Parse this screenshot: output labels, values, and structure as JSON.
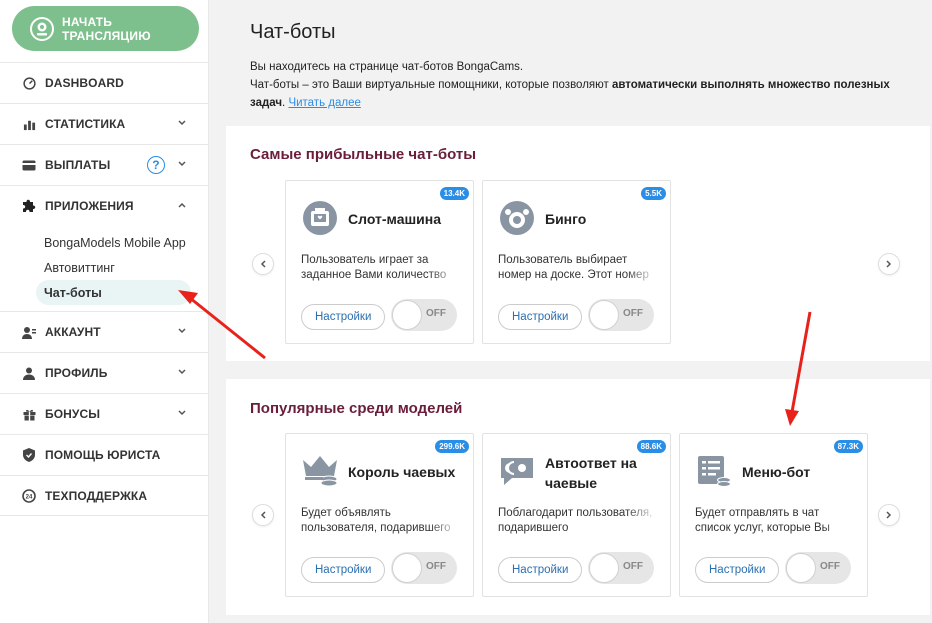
{
  "sidebar": {
    "start_label": "НАЧАТЬ ТРАНСЛЯЦИЮ",
    "items": [
      {
        "label": "DASHBOARD"
      },
      {
        "label": "СТАТИСТИКА"
      },
      {
        "label": "ВЫПЛАТЫ",
        "help": "?"
      },
      {
        "label": "ПРИЛОЖЕНИЯ"
      },
      {
        "label": "АККАУНТ"
      },
      {
        "label": "ПРОФИЛЬ"
      },
      {
        "label": "БОНУСЫ"
      },
      {
        "label": "ПОМОЩЬ ЮРИСТА"
      },
      {
        "label": "ТЕХПОДДЕРЖКА"
      }
    ],
    "subitems": [
      "BongaModels Mobile App",
      "Автовиттинг",
      "Чат-боты"
    ]
  },
  "main": {
    "title": "Чат-боты",
    "intro_line1": "Вы находитесь на странице чат-ботов BongaCams.",
    "intro_line2_a": "Чат-боты – это Ваши виртуальные помощники, которые позволяют ",
    "intro_line2_b": "автоматически выполнять множество полезных задач",
    "intro_line2_c": ". ",
    "read_more": "Читать далее",
    "sections": [
      {
        "title": "Самые прибыльные чат-боты",
        "cards": [
          {
            "name": "Слот-машина",
            "badge": "13.4K",
            "desc": "Пользователь играет за заданное Вами количество",
            "settings": "Настройки",
            "toggle": "OFF",
            "icon": "slot-machine-icon"
          },
          {
            "name": "Бинго",
            "badge": "5.5K",
            "desc": "Пользователь выбирает номер на доске. Этот номер",
            "settings": "Настройки",
            "toggle": "OFF",
            "icon": "bingo-icon"
          }
        ]
      },
      {
        "title": "Популярные среди моделей",
        "cards": [
          {
            "name": "Король чаевых",
            "badge": "299.6K",
            "desc": "Будет объявлять пользователя, подарившего",
            "settings": "Настройки",
            "toggle": "OFF",
            "icon": "crown-coins-icon"
          },
          {
            "name": "Автоответ на чаевые",
            "badge": "88.6K",
            "desc": "Поблагодарит пользователя, подарившего",
            "settings": "Настройки",
            "toggle": "OFF",
            "icon": "chat-bubble-icon"
          },
          {
            "name": "Меню-бот",
            "badge": "87.3K",
            "desc": "Будет отправлять в чат список услуг, которые Вы",
            "settings": "Настройки",
            "toggle": "OFF",
            "icon": "menu-list-icon"
          }
        ]
      }
    ]
  },
  "colors": {
    "accent_green": "#7ec08d",
    "badge_blue": "#2a8de6",
    "section_title": "#6a1e3a",
    "annotation_red": "#e8221b"
  }
}
